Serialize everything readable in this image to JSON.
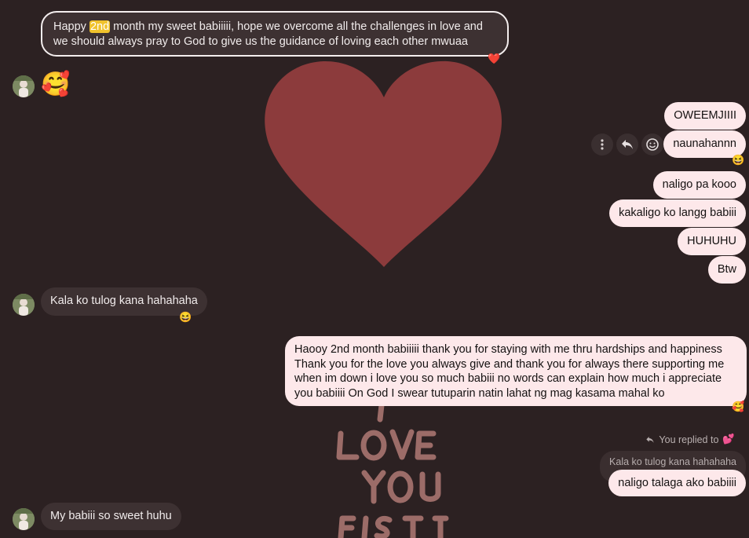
{
  "messages": {
    "pinned_greeting": {
      "text_before": "Happy ",
      "highlight": "2nd",
      "text_after": " month my sweet babiiiii, hope we overcome all the challenges in love and we should always pray to God to give us the guidance of loving each other mwuaa",
      "reaction": "❤️"
    },
    "sticker_emoji": "🥰",
    "out_1": "OWEEMJIIII",
    "out_2": "naunahannn",
    "out_2_reaction": "😆",
    "out_3": "naligo pa kooo",
    "out_4": "kakaligo ko langg babiii",
    "out_5": "HUHUHU",
    "out_6": "Btw",
    "in_kala": "Kala ko tulog kana hahahaha",
    "in_kala_reaction": "😆",
    "out_long": "Haooy 2nd month babiiiii thank you for staying with me thru hardships and happiness Thank you for the love you always give and thank you for always there supporting me when im down i love you so much babiii no words can explain how much i appreciate you babiiii On God I swear tutuparin natin lahat ng mag kasama mahal ko",
    "out_long_reaction": "🥰",
    "reply_header": "You replied to",
    "reply_header_emoji": "💕",
    "reply_quoted": "Kala ko tulog kana hahahaha",
    "reply_text": "naligo talaga ako babiiii",
    "in_last": "My babiii so sweet huhu"
  },
  "colors": {
    "background": "#2c2122",
    "incoming_bubble": "#3d3132",
    "outgoing_bubble": "#fde8ea",
    "heart": "#8c3b3c",
    "highlight": "#f0c22c"
  },
  "icons": [
    "more-icon",
    "reply-icon",
    "emoji-icon",
    "reply-arrow-icon"
  ]
}
